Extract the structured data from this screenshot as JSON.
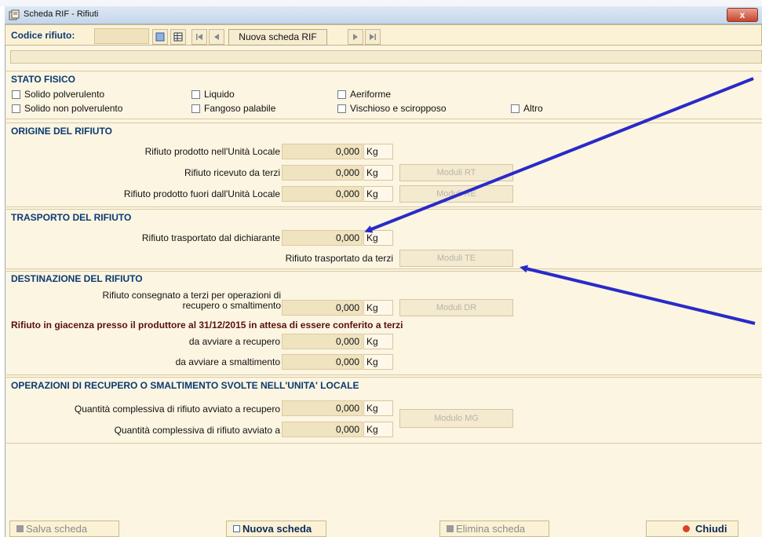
{
  "window": {
    "title": "Scheda RIF - Rifiuti",
    "close_label": "x"
  },
  "toolbar": {
    "code_label": "Codice rifiuto:",
    "code_value": "",
    "new_rif_label": "Nuova scheda RIF"
  },
  "stato_fisico": {
    "title": "STATO FISICO",
    "options": [
      "Solido polverulento",
      "Liquido",
      "Aeriforme",
      "Solido non polverulento",
      "Fangoso palabile",
      "Vischioso e sciropposo",
      "Altro"
    ]
  },
  "origine": {
    "title": "ORIGINE DEL RIFIUTO",
    "rows": [
      {
        "label": "Rifiuto prodotto nell'Unità Locale",
        "value": "0,000",
        "unit": "Kg"
      },
      {
        "label": "Rifiuto ricevuto da terzi",
        "value": "0,000",
        "unit": "Kg",
        "button": "Moduli RT"
      },
      {
        "label": "Rifiuto prodotto fuori dall'Unità Locale",
        "value": "0,000",
        "unit": "Kg",
        "button": "Moduli RE"
      }
    ]
  },
  "trasporto": {
    "title": "TRASPORTO DEL RIFIUTO",
    "row1": {
      "label": "Rifiuto trasportato dal dichiarante",
      "value": "0,000",
      "unit": "Kg"
    },
    "row2": {
      "label": "Rifiuto trasportato da terzi",
      "button": "Moduli TE"
    }
  },
  "destinazione": {
    "title": "DESTINAZIONE DEL RIFIUTO",
    "consegnato_line1": "Rifiuto consegnato a terzi per operazioni di",
    "consegnato_line2": "recupero o smaltimento",
    "consegnato_value": "0,000",
    "consegnato_unit": "Kg",
    "consegnato_button": "Moduli DR",
    "giacenza": "Rifiuto in giacenza presso il produttore al 31/12/2015 in attesa di essere conferito a terzi",
    "recupero": {
      "label": "da avviare a recupero",
      "value": "0,000",
      "unit": "Kg"
    },
    "smaltimento": {
      "label": "da avviare a smaltimento",
      "value": "0,000",
      "unit": "Kg"
    }
  },
  "operazioni": {
    "title": "OPERAZIONI DI RECUPERO O SMALTIMENTO SVOLTE NELL'UNITA' LOCALE",
    "recupero": {
      "label": "Quantità complessiva di rifiuto avviato a recupero",
      "value": "0,000",
      "unit": "Kg"
    },
    "smaltimento": {
      "label": "Quantità complessiva di rifiuto avviato a",
      "value": "0,000",
      "unit": "Kg"
    },
    "button": "Modulo MG"
  },
  "footer": {
    "salva": "Salva scheda",
    "nuova": "Nuova scheda",
    "elimina": "Elimina scheda",
    "chiudi": "Chiudi"
  },
  "colors": {
    "section_title": "#0c3a74",
    "giacenza": "#5a1010",
    "arrow": "#2a2ac8",
    "background": "#fbf5e1"
  }
}
